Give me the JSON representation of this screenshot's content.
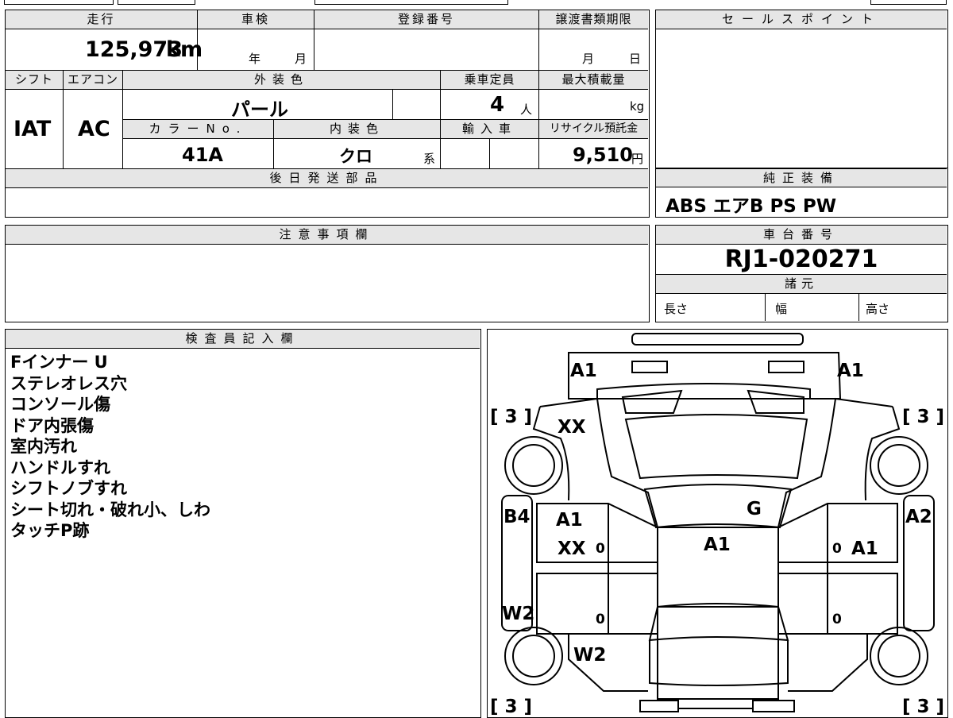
{
  "vehicle": {
    "mileage_label": "走行",
    "mileage_value": "125,973",
    "mileage_unit": "km",
    "inspection_label": "車検",
    "inspection_year": "年",
    "inspection_month": "月",
    "registration_label": "登録番号",
    "registration_value": "",
    "transfer_deadline_label": "譲渡書類期限",
    "transfer_month": "月",
    "transfer_day": "日",
    "shift_label": "シフト",
    "shift_value": "IAT",
    "aircon_label": "エアコン",
    "aircon_value": "AC",
    "exterior_color_label": "外装色",
    "exterior_color_value": "パール",
    "capacity_label": "乗車定員",
    "capacity_value": "4",
    "capacity_unit": "人",
    "max_load_label": "最大積載量",
    "max_load_unit": "kg",
    "color_no_label": "カラーNo.",
    "color_no_value": "41A",
    "interior_color_label": "内装色",
    "interior_color_value": "クロ",
    "interior_color_suffix": "系",
    "import_label": "輸入車",
    "recycle_label": "リサイクル預託金",
    "recycle_value": "9,510",
    "recycle_unit": "円"
  },
  "sections": {
    "later_parts_label": "後日発送部品",
    "sales_point_label": "セールスポイント",
    "genuine_equipment_label": "純正装備",
    "genuine_equipment_value": "ABS エアB PS PW",
    "notes_label": "注意事項欄",
    "chassis_label": "車台番号",
    "chassis_value": "RJ1-020271",
    "specs_label": "諸元",
    "spec_length": "長さ",
    "spec_width": "幅",
    "spec_height": "高さ",
    "inspector_label": "検査員記入欄"
  },
  "inspector_notes": [
    "Fインナー U",
    "ステレオレス穴",
    "コンソール傷",
    "ドア内張傷",
    "室内汚れ",
    "ハンドルすれ",
    "シフトノブすれ",
    "シート切れ・破れ小、しわ",
    "タッチP跡"
  ],
  "diagram": {
    "seat_front_left": "A1",
    "seat_front_right": "A1",
    "front_left_bracket": "[ 3 ]",
    "front_right_bracket": "[ 3 ]",
    "rear_left_bracket": "[ 3 ]",
    "rear_right_bracket": "[ 3 ]",
    "dash_left": "XX",
    "pillar_left": "B4",
    "pillar_right": "A2",
    "door_front_left_1": "A1",
    "door_front_left_2": "XX",
    "floor_center": "A1",
    "glass_mark": "G",
    "door_front_right": "A1",
    "left_lower": "W2",
    "left_rear": "W2",
    "zero_1": "0",
    "zero_2": "0",
    "zero_3": "0",
    "zero_4": "0"
  }
}
